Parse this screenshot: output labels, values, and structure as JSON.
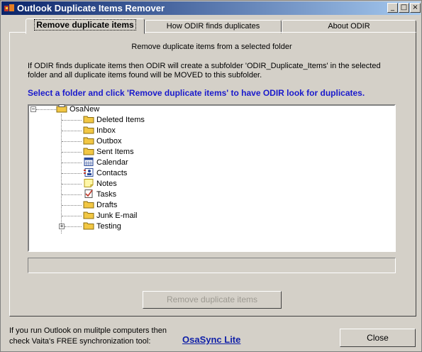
{
  "window": {
    "title": "Outlook Duplicate Items Remover",
    "controls": {
      "minimize": "_",
      "maximize": "□",
      "close": "×"
    }
  },
  "tabs": [
    {
      "label": "Remove duplicate items",
      "active": true
    },
    {
      "label": "How ODIR finds duplicates",
      "active": false
    },
    {
      "label": "About ODIR",
      "active": false
    }
  ],
  "panel": {
    "heading": "Remove duplicate items from a selected folder",
    "info_line1": "If ODIR finds duplicate items then ODIR will create a subfolder 'ODIR_Duplicate_Items' in the selected",
    "info_line2": "folder and all duplicate items found will be MOVED to this subfolder.",
    "instruction": "Select a folder and click 'Remove duplicate items' to have ODIR look for duplicates."
  },
  "tree": {
    "root": {
      "label": "OsaNew",
      "icon": "store-icon",
      "expanded": true
    },
    "items": [
      {
        "label": "Deleted Items",
        "icon": "folder-icon"
      },
      {
        "label": "Inbox",
        "icon": "folder-icon"
      },
      {
        "label": "Outbox",
        "icon": "folder-icon"
      },
      {
        "label": "Sent Items",
        "icon": "folder-icon"
      },
      {
        "label": "Calendar",
        "icon": "calendar-icon"
      },
      {
        "label": "Contacts",
        "icon": "contacts-icon"
      },
      {
        "label": "Notes",
        "icon": "notes-icon"
      },
      {
        "label": "Tasks",
        "icon": "tasks-icon"
      },
      {
        "label": "Drafts",
        "icon": "folder-icon"
      },
      {
        "label": "Junk E-mail",
        "icon": "folder-icon"
      },
      {
        "label": "Testing",
        "icon": "folder-icon",
        "has_children": true
      }
    ]
  },
  "buttons": {
    "remove": "Remove duplicate items",
    "close": "Close"
  },
  "footer": {
    "line1": "If you run Outlook on mulitple computers then",
    "line2": "check Vaita's FREE synchronization tool:",
    "link": "OsaSync Lite"
  },
  "colors": {
    "face": "#d4d0c8",
    "title_start": "#0a246a",
    "title_end": "#a6caf0",
    "instruction": "#1a1acc",
    "link": "#0f1fa8",
    "folder": "#f2c744"
  }
}
